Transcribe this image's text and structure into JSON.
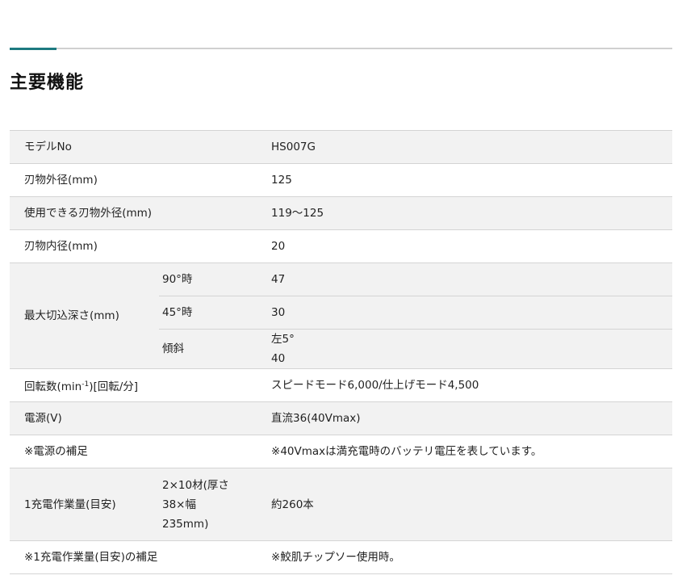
{
  "section": {
    "title": "主要機能"
  },
  "specs": {
    "model": {
      "label": "モデルNo",
      "value": "HS007G"
    },
    "blade_outer": {
      "label": "刃物外径(mm)",
      "value": "125"
    },
    "usable_blade_outer": {
      "label": "使用できる刃物外径(mm)",
      "value": "119～125"
    },
    "blade_inner": {
      "label": "刃物内径(mm)",
      "value": "20"
    },
    "max_cut_depth": {
      "label": "最大切込深さ(mm)",
      "rows": [
        {
          "sub": "90°時",
          "value": "47"
        },
        {
          "sub": "45°時",
          "value": "30"
        },
        {
          "sub": "傾斜",
          "value_line1": "左5°",
          "value_line2": "40"
        }
      ]
    },
    "rpm": {
      "label_prefix": "回転数(min",
      "label_sup": "-1",
      "label_suffix": ")[回転/分]",
      "value": "スピードモード6,000/仕上げモード4,500"
    },
    "power": {
      "label": "電源(V)",
      "value": "直流36(40Vmax)"
    },
    "power_note": {
      "label": "※電源の補足",
      "value": "※40Vmaxは満充電時のバッテリ電圧を表しています。"
    },
    "work_per_charge": {
      "label": "1充電作業量(目安)",
      "sub_lines": [
        "2×10材(厚さ",
        "38×幅",
        "235mm)"
      ],
      "value": "約260本"
    },
    "work_note": {
      "label": "※1充電作業量(目安)の補足",
      "value": "※鮫肌チップソー使用時。"
    }
  }
}
